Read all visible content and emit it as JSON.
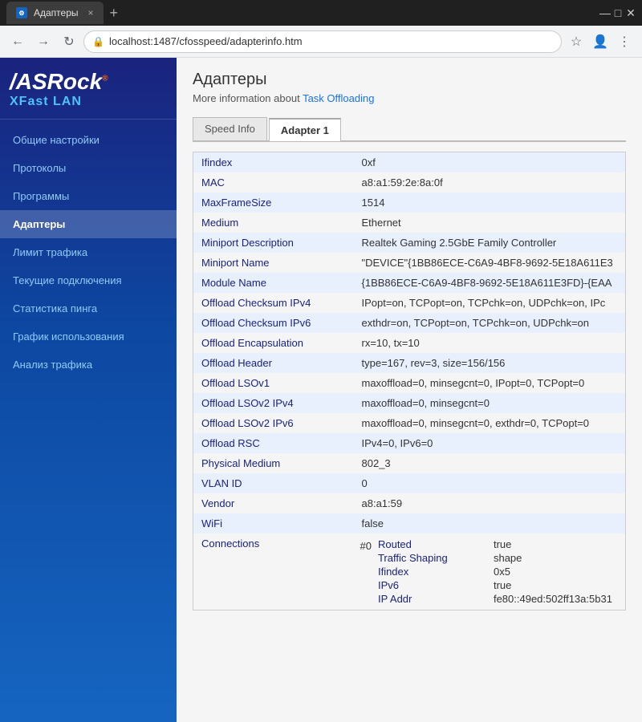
{
  "window": {
    "title": "Адаптеры",
    "url": "localhost:1487/cfosspeed/adapterinfo.htm"
  },
  "sidebar": {
    "logo_main": "ASRock",
    "logo_sub": "XFast LAN",
    "items": [
      {
        "label": "Общие настройки",
        "active": false
      },
      {
        "label": "Протоколы",
        "active": false
      },
      {
        "label": "Программы",
        "active": false
      },
      {
        "label": "Адаптеры",
        "active": true
      },
      {
        "label": "Лимит трафика",
        "active": false
      },
      {
        "label": "Текущие подключения",
        "active": false
      },
      {
        "label": "Статистика пинга",
        "active": false
      },
      {
        "label": "График использования",
        "active": false
      },
      {
        "label": "Анализ трафика",
        "active": false
      }
    ]
  },
  "content": {
    "page_title": "Адаптеры",
    "more_info_text": "More information about",
    "more_info_link": "Task Offloading",
    "tabs": [
      {
        "label": "Speed Info",
        "active": false
      },
      {
        "label": "Adapter 1",
        "active": true
      }
    ],
    "table_rows": [
      {
        "key": "Ifindex",
        "value": "0xf"
      },
      {
        "key": "MAC",
        "value": "a8:a1:59:2e:8a:0f"
      },
      {
        "key": "MaxFrameSize",
        "value": "1514"
      },
      {
        "key": "Medium",
        "value": "Ethernet"
      },
      {
        "key": "Miniport Description",
        "value": "Realtek Gaming 2.5GbE Family Controller"
      },
      {
        "key": "Miniport Name",
        "value": "\"DEVICE\"{1BB86ECE-C6A9-4BF8-9692-5E18A611E3"
      },
      {
        "key": "Module Name",
        "value": "{1BB86ECE-C6A9-4BF8-9692-5E18A611E3FD}-{EAA"
      },
      {
        "key": "Offload Checksum IPv4",
        "value": "IPopt=on, TCPopt=on, TCPchk=on, UDPchk=on, IPc"
      },
      {
        "key": "Offload Checksum IPv6",
        "value": "exthdr=on, TCPopt=on, TCPchk=on, UDPchk=on"
      },
      {
        "key": "Offload Encapsulation",
        "value": "rx=10, tx=10"
      },
      {
        "key": "Offload Header",
        "value": "type=167, rev=3, size=156/156"
      },
      {
        "key": "Offload LSOv1",
        "value": "maxoffload=0, minsegcnt=0, IPopt=0, TCPopt=0"
      },
      {
        "key": "Offload LSOv2 IPv4",
        "value": "maxoffload=0, minsegcnt=0"
      },
      {
        "key": "Offload LSOv2 IPv6",
        "value": "maxoffload=0, minsegcnt=0, exthdr=0, TCPopt=0"
      },
      {
        "key": "Offload RSC",
        "value": "IPv4=0, IPv6=0"
      },
      {
        "key": "Physical Medium",
        "value": "802_3"
      },
      {
        "key": "VLAN ID",
        "value": "0"
      },
      {
        "key": "Vendor",
        "value": "a8:a1:59"
      },
      {
        "key": "WiFi",
        "value": "false"
      }
    ],
    "connections_label": "Connections",
    "connections": [
      {
        "index": "#0",
        "fields": [
          {
            "key": "Routed",
            "value": "true"
          },
          {
            "key": "Traffic Shaping",
            "value": "shape"
          },
          {
            "key": "Ifindex",
            "value": "0x5"
          },
          {
            "key": "IPv6",
            "value": "true"
          },
          {
            "key": "IP Addr",
            "value": "fe80::49ed:502ff13a:5b31"
          }
        ]
      }
    ]
  },
  "icons": {
    "back": "←",
    "forward": "→",
    "reload": "↻",
    "lock": "🔒",
    "star": "☆",
    "account": "👤",
    "menu": "⋮",
    "new_tab": "+",
    "close_tab": "×",
    "minimize": "—",
    "maximize": "□",
    "close_win": "✕"
  }
}
